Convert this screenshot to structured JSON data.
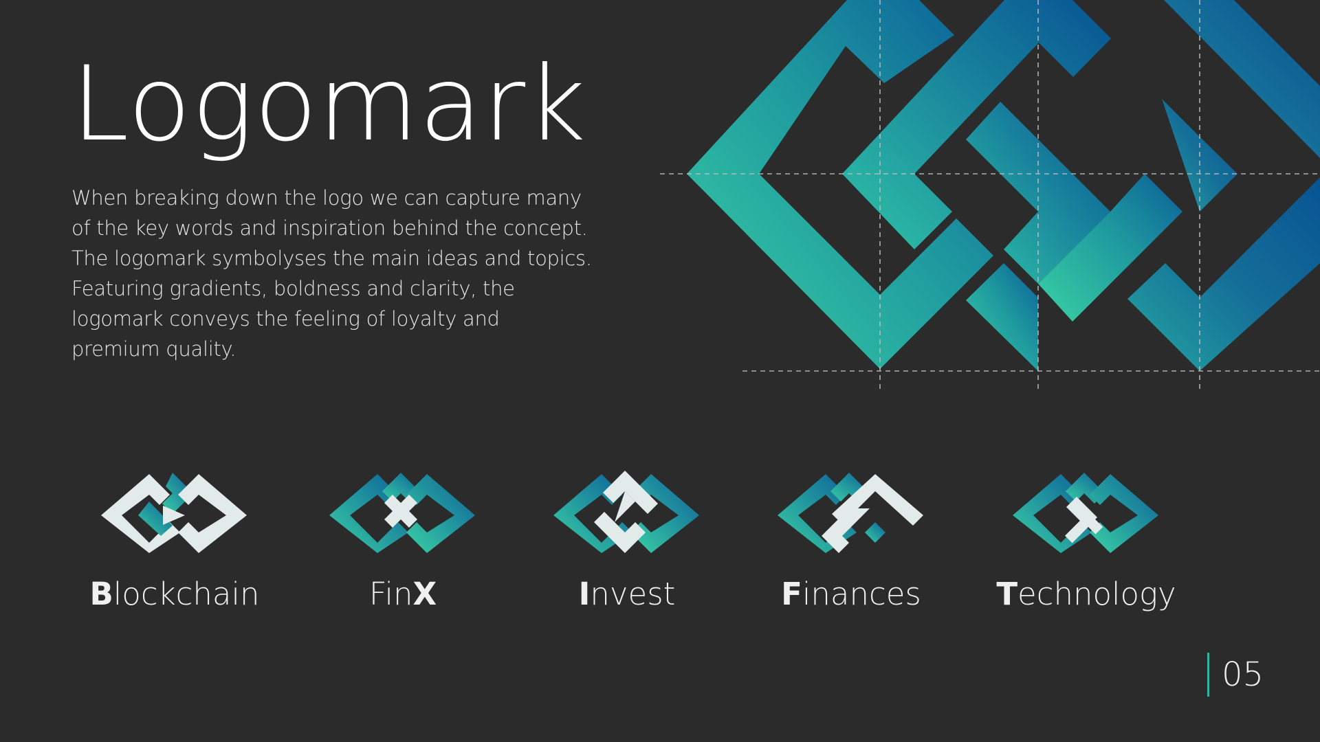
{
  "slide": {
    "title": "Logomark",
    "description_lines": [
      "When breaking down the logo we can capture many",
      "of the key words and inspiration behind the concept.",
      "The logomark symbolyses the main ideas and topics.",
      "Featuring gradients, boldness and clarity, the",
      "logomark conveys the feeling of loyalty and",
      "premium quality."
    ],
    "page_number": "05"
  },
  "variants": [
    {
      "initial": "B",
      "rest": "lockchain",
      "highlight": "B"
    },
    {
      "initial": "Fin",
      "rest": "X",
      "highlight": "X"
    },
    {
      "initial": "I",
      "rest": "nvest",
      "highlight": "I"
    },
    {
      "initial": "F",
      "rest": "inances",
      "highlight": "F"
    },
    {
      "initial": "T",
      "rest": "echnology",
      "highlight": "T"
    }
  ],
  "colors": {
    "background": "#2b2b2b",
    "gradient_green": "#3ad1a4",
    "gradient_blue": "#0b5e99",
    "accent_line": "#2fb59a",
    "white_mark": "#e4ecec"
  }
}
